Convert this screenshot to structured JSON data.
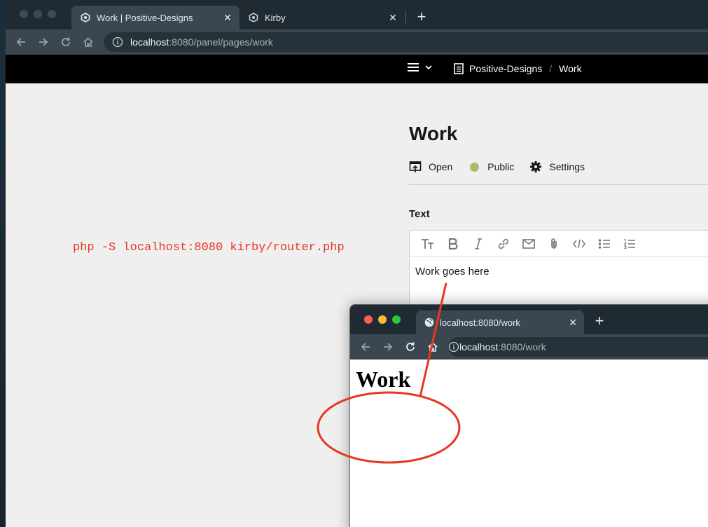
{
  "main_browser": {
    "tabs": [
      {
        "title": "Work | Positive-Designs",
        "active": true
      },
      {
        "title": "Kirby",
        "active": false
      }
    ],
    "url": {
      "host": "localhost",
      "rest": ":8080/panel/pages/work"
    }
  },
  "panel": {
    "breadcrumb": [
      "Positive-Designs",
      "Work"
    ],
    "page_title": "Work",
    "options": {
      "open": "Open",
      "status": "Public",
      "settings": "Settings"
    },
    "status_color": "#a7bd68",
    "field_label": "Text",
    "editor_content": "Work goes here",
    "toolbar_icons": [
      "headings-icon",
      "bold-icon",
      "italic-icon",
      "link-icon",
      "email-icon",
      "attachment-icon",
      "code-icon",
      "bullet-list-icon",
      "ordered-list-icon"
    ]
  },
  "annotation": {
    "command": "php -S localhost:8080 kirby/router.php",
    "color": "#e8381f"
  },
  "preview_browser": {
    "tab_title": "localhost:8080/work",
    "url": {
      "host": "localhost",
      "rest": ":8080/work"
    },
    "heading": "Work"
  }
}
